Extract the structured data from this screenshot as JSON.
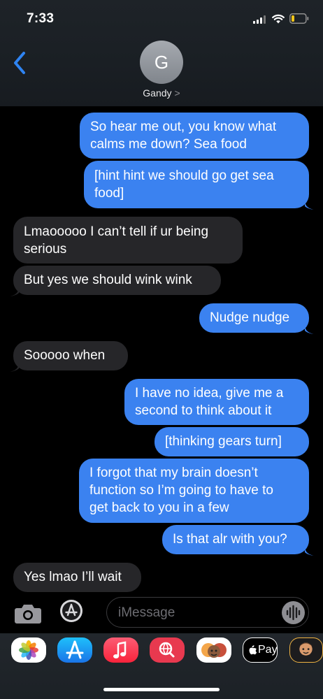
{
  "status": {
    "time": "7:33"
  },
  "header": {
    "avatar_initial": "G",
    "contact_name": "Gandy",
    "contact_chevron": ">"
  },
  "messages": [
    {
      "from": "me",
      "text": "So hear me out, you know what\ncalms me down? Sea food"
    },
    {
      "from": "me",
      "text": "[hint hint we should go get sea\nfood]"
    },
    {
      "from": "them",
      "text": "Lmaooooo I can’t tell if ur being\nserious"
    },
    {
      "from": "them",
      "text": "But yes we should wink wink"
    },
    {
      "from": "me",
      "text": "Nudge nudge"
    },
    {
      "from": "them",
      "text": "Sooooo when"
    },
    {
      "from": "me",
      "text": "I have no idea, give me a\nsecond to think about it"
    },
    {
      "from": "me",
      "text": "[thinking gears turn]"
    },
    {
      "from": "me",
      "text": "I forgot that my brain doesn’t\nfunction so I’m going to have to\nget back to you in a few"
    },
    {
      "from": "me",
      "text": "Is that alr with you?"
    },
    {
      "from": "them",
      "text": "Yes lmao I’ll wait"
    }
  ],
  "input": {
    "placeholder": "iMessage"
  },
  "drawer": {
    "apps": [
      {
        "name": "photos-icon"
      },
      {
        "name": "app-store-icon"
      },
      {
        "name": "music-icon"
      },
      {
        "name": "search-images-icon"
      },
      {
        "name": "memoji-stickers-icon"
      },
      {
        "name": "apple-pay-icon",
        "label": "Pay"
      },
      {
        "name": "memoji-icon"
      }
    ]
  },
  "colors": {
    "sent_bubble": "#3b82f0",
    "received_bubble": "#262629",
    "accent": "#2f84f2"
  }
}
